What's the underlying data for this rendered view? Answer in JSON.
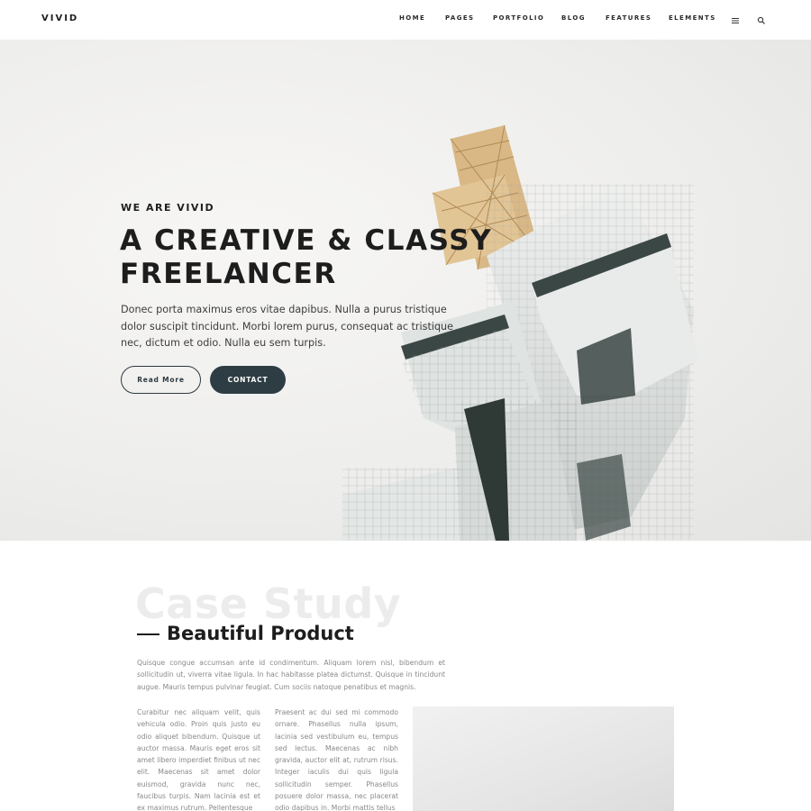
{
  "header": {
    "logo": "VIVID",
    "nav": [
      {
        "label": "HOME"
      },
      {
        "label": "PAGES"
      },
      {
        "label": "PORTFOLIO"
      },
      {
        "label": "BLOG"
      },
      {
        "label": "FEATURES"
      },
      {
        "label": "ELEMENTS"
      }
    ],
    "icons": [
      "menu-icon",
      "search-icon"
    ]
  },
  "hero": {
    "eyebrow": "WE ARE VIVID",
    "title_line1": "A CREATIVE & CLASSY",
    "title_line2": "FREELANCER",
    "text": "Donec porta maximus eros vitae dapibus. Nulla a purus tristique dolor suscipit tincidunt. Morbi lorem purus, consequat ac tristique nec, dictum et odio. Nulla eu sem turpis.",
    "btn_read_more": "Read More",
    "btn_contact": "CONTACT"
  },
  "case_study": {
    "background_title": "Case Study",
    "title": "Beautiful Product",
    "intro": "Quisque congue accumsan ante id condimentum. Aliquam lorem nisl, bibendum et sollicitudin ut, viverra vitae ligula. In hac habitasse platea dictumst. Quisque in tincidunt augue. Mauris tempus pulvinar feugiat. Cum sociis natoque penatibus et magnis.",
    "col1": "Curabitur nec aliquam velit, quis vehicula odio. Proin quis justo eu odio aliquet bibendum. Quisque ut auctor massa. Mauris eget eros sit amet libero imperdiet finibus ut nec elit. Maecenas sit amet dolor euismod, gravida nunc nec, faucibus turpis. Nam lacinia est et ex maximus rutrum. Pellentesque",
    "col2": "Praesent ac dui sed mi commodo ornare. Phasellus nulla ipsum, lacinia sed vestibulum eu, tempus sed lectus. Maecenas ac nibh gravida, auctor elit at, rutrum risus. Integer iaculis dui quis ligula sollicitudin semper. Phasellus posuere dolor massa, nec placerat odio dapibus in. Morbi mattis tellus"
  },
  "colors": {
    "accent": "#2e3d44",
    "text": "#1d1d1d",
    "muted": "#888888"
  }
}
